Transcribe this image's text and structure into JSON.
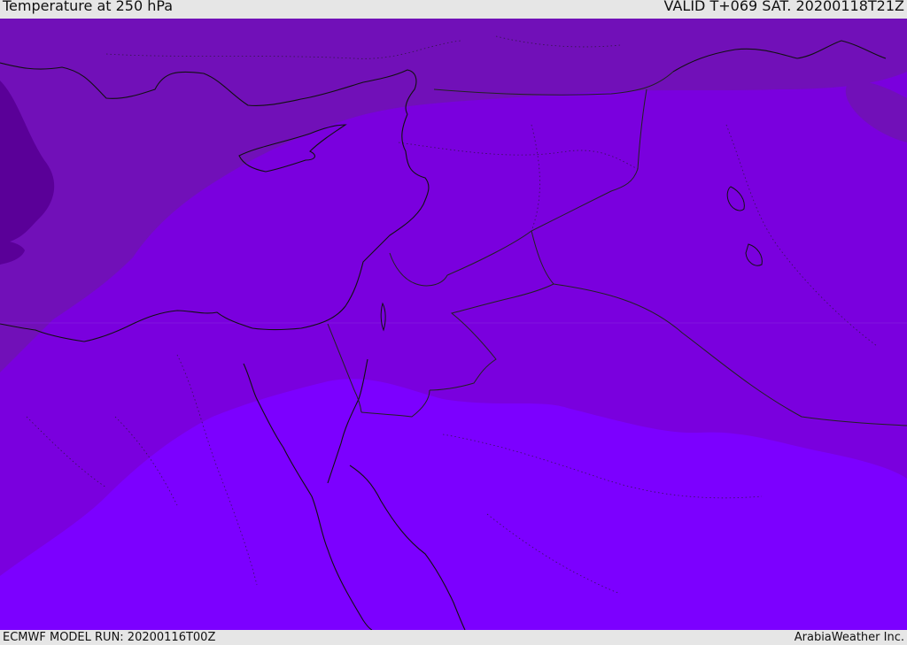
{
  "header": {
    "title": "Temperature at 250 hPa",
    "valid": "VALID T+069 SAT. 20200118T21Z"
  },
  "footer": {
    "model_run": "ECMWF MODEL RUN: 20200116T00Z",
    "credit": "ArabiaWeather Inc."
  },
  "colors": {
    "band_darkest": "#5a0098",
    "band_dark": "#7110b8",
    "band_mid": "#7a00de",
    "band_light": "#7c00ff",
    "coastline": "#111111",
    "border": "#222222"
  }
}
